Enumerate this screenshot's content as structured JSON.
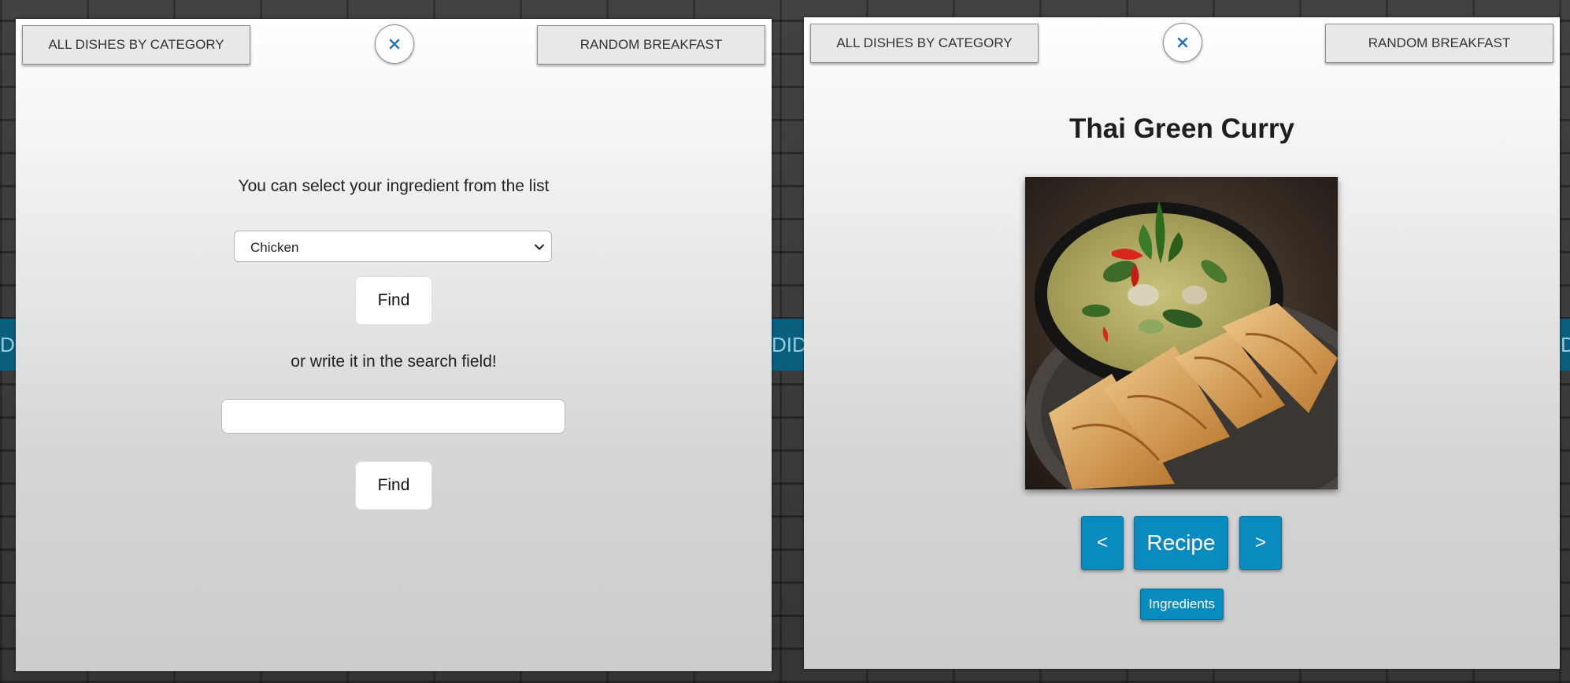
{
  "nav": {
    "all_dishes_label": "ALL DISHES BY CATEGORY",
    "random_breakfast_label": "RANDOM BREAKFAST",
    "close_icon": "close-icon"
  },
  "background": {
    "band_text_left": "D",
    "band_text_middle": "DID",
    "band_text_right": "D"
  },
  "search_panel": {
    "select_prompt": "You can select your ingredient from the list",
    "selected_ingredient": "Chicken",
    "find_label": "Find",
    "write_prompt": "or write it in the search field!",
    "search_value": "",
    "search_placeholder": "",
    "find2_label": "Find"
  },
  "dish_panel": {
    "title": "Thai Green Curry",
    "prev_label": "<",
    "recipe_label": "Recipe",
    "next_label": ">",
    "ingredients_label": "Ingredients"
  },
  "colors": {
    "accent_blue": "#0a8bbf",
    "close_icon_blue": "#2a73b8"
  }
}
